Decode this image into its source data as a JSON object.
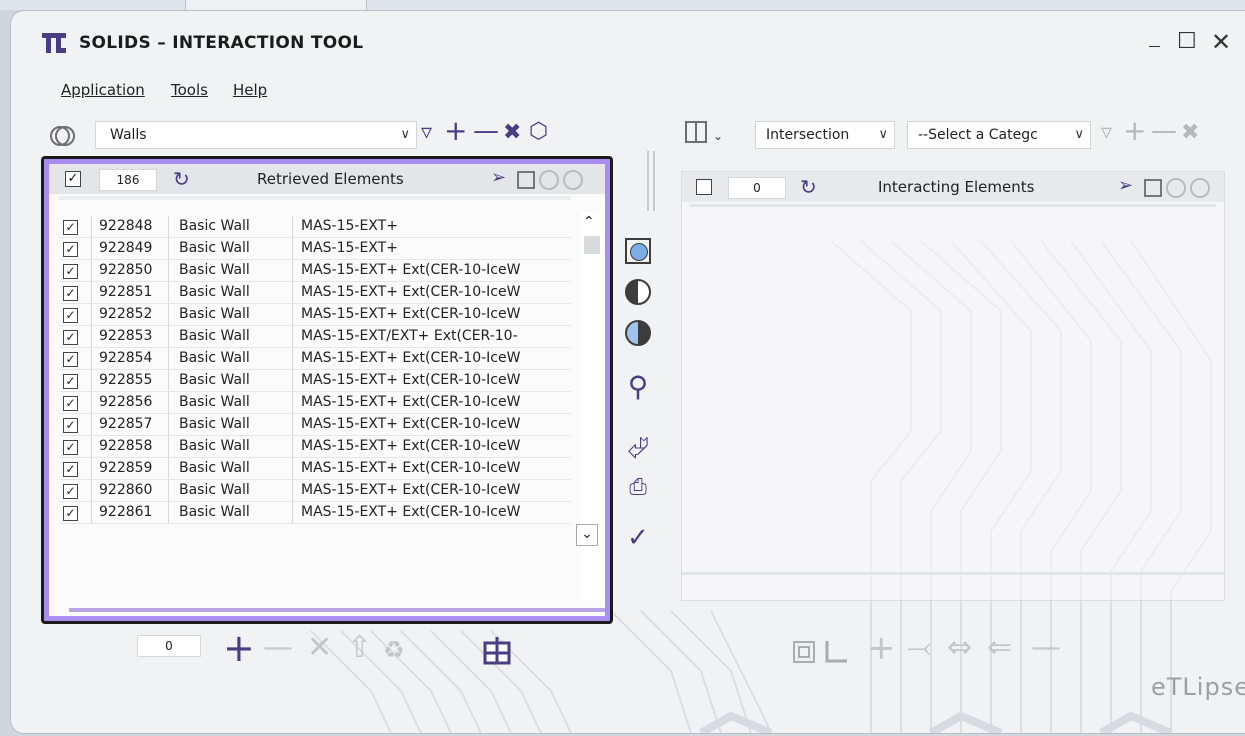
{
  "app": {
    "title": "SOLIDS – INTERACTION TOOL",
    "watermark": "eTLipse"
  },
  "menu": [
    {
      "label": "Application"
    },
    {
      "label": "Tools"
    },
    {
      "label": "Help"
    }
  ],
  "left_toolbar": {
    "category": "Walls"
  },
  "right_toolbar": {
    "mode": "Intersection",
    "category_placeholder": "--Select a Categc"
  },
  "left_panel": {
    "count": "186",
    "title": "Retrieved Elements",
    "rows": [
      {
        "id": "922848",
        "family": "Basic Wall",
        "type": "MAS-15-EXT+"
      },
      {
        "id": "922849",
        "family": "Basic Wall",
        "type": "MAS-15-EXT+"
      },
      {
        "id": "922850",
        "family": "Basic Wall",
        "type": "MAS-15-EXT+ Ext(CER-10-IceW"
      },
      {
        "id": "922851",
        "family": "Basic Wall",
        "type": "MAS-15-EXT+ Ext(CER-10-IceW"
      },
      {
        "id": "922852",
        "family": "Basic Wall",
        "type": "MAS-15-EXT+ Ext(CER-10-IceW"
      },
      {
        "id": "922853",
        "family": "Basic Wall",
        "type": "MAS-15-EXT/EXT+ Ext(CER-10-"
      },
      {
        "id": "922854",
        "family": "Basic Wall",
        "type": "MAS-15-EXT+ Ext(CER-10-IceW"
      },
      {
        "id": "922855",
        "family": "Basic Wall",
        "type": "MAS-15-EXT+ Ext(CER-10-IceW"
      },
      {
        "id": "922856",
        "family": "Basic Wall",
        "type": "MAS-15-EXT+ Ext(CER-10-IceW"
      },
      {
        "id": "922857",
        "family": "Basic Wall",
        "type": "MAS-15-EXT+ Ext(CER-10-IceW"
      },
      {
        "id": "922858",
        "family": "Basic Wall",
        "type": "MAS-15-EXT+ Ext(CER-10-IceW"
      },
      {
        "id": "922859",
        "family": "Basic Wall",
        "type": "MAS-15-EXT+ Ext(CER-10-IceW"
      },
      {
        "id": "922860",
        "family": "Basic Wall",
        "type": "MAS-15-EXT+ Ext(CER-10-IceW"
      },
      {
        "id": "922861",
        "family": "Basic Wall",
        "type": "MAS-15-EXT+ Ext(CER-10-IceW"
      }
    ]
  },
  "right_panel": {
    "count": "0",
    "title": "Interacting Elements"
  },
  "bottom_left": {
    "count": "0"
  },
  "colors": {
    "accent": "#4a3d83",
    "selection_border": "#a98df0",
    "disabled": "#b6b8be"
  }
}
